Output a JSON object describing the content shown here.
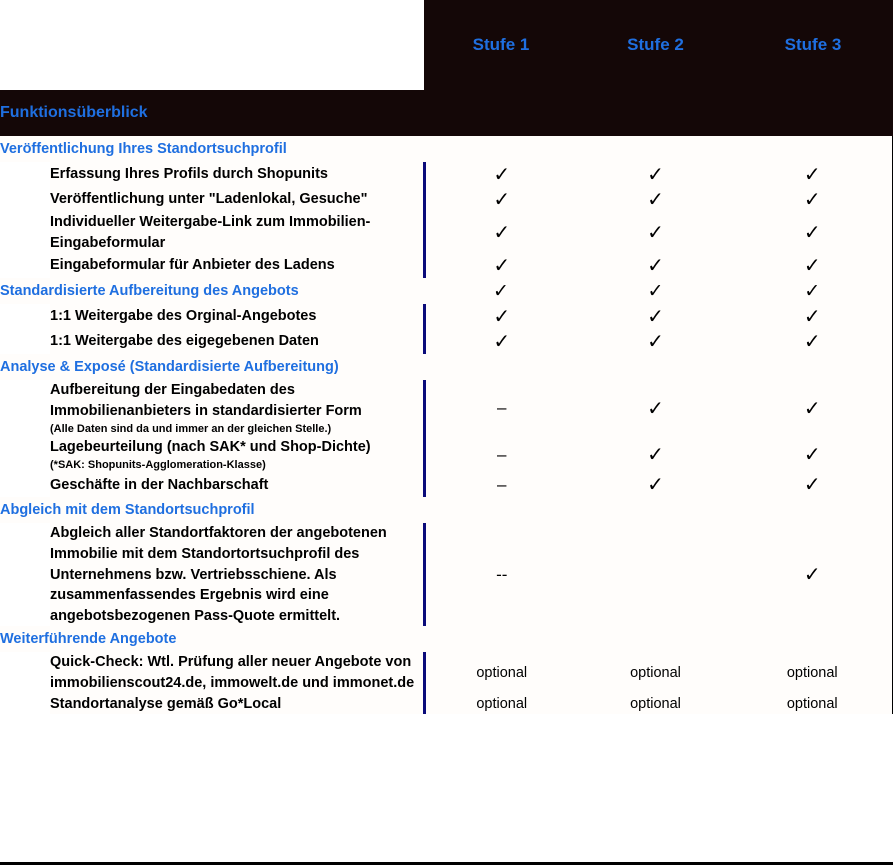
{
  "colors": {
    "accent_blue": "#1f6fe0",
    "dark_band": "#140707",
    "cyan_rule": "#00c8d7",
    "navy_rule": "#0b0b7a",
    "cell_bg": "#fffdfb",
    "text_black": "#000000"
  },
  "header": {
    "blank_label": "",
    "columns": [
      {
        "label": "Stufe 1"
      },
      {
        "label": "Stufe 2"
      },
      {
        "label": "Stufe 3"
      }
    ]
  },
  "title_band": {
    "label": "Funktionsüberblick"
  },
  "glyphs": {
    "check": "✓",
    "dash": "–",
    "double_dash": "--",
    "empty": ""
  },
  "sections": [
    {
      "heading": "Veröffentlichung Ihres Standortsuchprofil",
      "heading_marks": [
        "",
        "",
        ""
      ],
      "rows": [
        {
          "label": "Erfassung Ihres Profils durch Shopunits",
          "sub": "",
          "marks": [
            "✓",
            "✓",
            "✓"
          ]
        },
        {
          "label": "Veröffentlichung unter \"Ladenlokal, Gesuche\"",
          "sub": "",
          "marks": [
            "✓",
            "✓",
            "✓"
          ]
        },
        {
          "label": "Individueller Weitergabe-Link zum Immobilien-Eingabeformular",
          "sub": "",
          "marks": [
            "✓",
            "✓",
            "✓"
          ]
        },
        {
          "label": "Eingabeformular für Anbieter des Ladens",
          "sub": "",
          "marks": [
            "✓",
            "✓",
            "✓"
          ]
        }
      ]
    },
    {
      "heading": "Standardisierte Aufbereitung des Angebots",
      "heading_marks": [
        "✓",
        "✓",
        "✓"
      ],
      "rows": [
        {
          "label": "1:1 Weitergabe des Orginal-Angebotes",
          "sub": "",
          "marks": [
            "✓",
            "✓",
            "✓"
          ]
        },
        {
          "label": "1:1 Weitergabe des eigegebenen Daten",
          "sub": "",
          "marks": [
            "✓",
            "✓",
            "✓"
          ]
        }
      ]
    },
    {
      "heading": "Analyse & Exposé (Standardisierte Aufbereitung)",
      "heading_marks": [
        "",
        "",
        ""
      ],
      "rows": [
        {
          "label": "Aufbereitung der Eingabedaten des Immobilienanbieters in standardisierter Form",
          "sub": "(Alle Daten sind da und immer an der gleichen Stelle.)",
          "marks": [
            "–",
            "✓",
            "✓"
          ]
        },
        {
          "label": "Lagebeurteilung (nach SAK* und Shop-Dichte)",
          "sub": "(*SAK: Shopunits-Agglomeration-Klasse)",
          "marks": [
            "–",
            "✓",
            "✓"
          ]
        },
        {
          "label": "Geschäfte in der Nachbarschaft",
          "sub": "",
          "marks": [
            "–",
            "✓",
            "✓"
          ]
        }
      ]
    },
    {
      "heading": "Abgleich mit dem Standortsuchprofil",
      "heading_marks": [
        "",
        "",
        ""
      ],
      "rows": [
        {
          "label": "Abgleich aller Standortfaktoren der angebotenen Immobilie mit dem Standortortsuchprofil des Unternehmens bzw. Vertriebsschiene. Als zusammenfassendes Ergebnis wird eine angebotsbezogenen Pass-Quote ermittelt.",
          "sub": "",
          "marks": [
            "--",
            "",
            "✓"
          ]
        }
      ]
    },
    {
      "heading": "Weiterführende Angebote",
      "heading_marks": [
        "",
        "",
        ""
      ],
      "rows": [
        {
          "label": "Quick-Check: Wtl. Prüfung aller neuer Angebote von immobilienscout24.de, immowelt.de und immonet.de",
          "sub": "",
          "marks": [
            "optional",
            "optional",
            "optional"
          ]
        },
        {
          "label": "Standortanalyse gemäß Go*Local",
          "sub": "",
          "marks": [
            "optional",
            "optional",
            "optional"
          ]
        }
      ]
    }
  ]
}
